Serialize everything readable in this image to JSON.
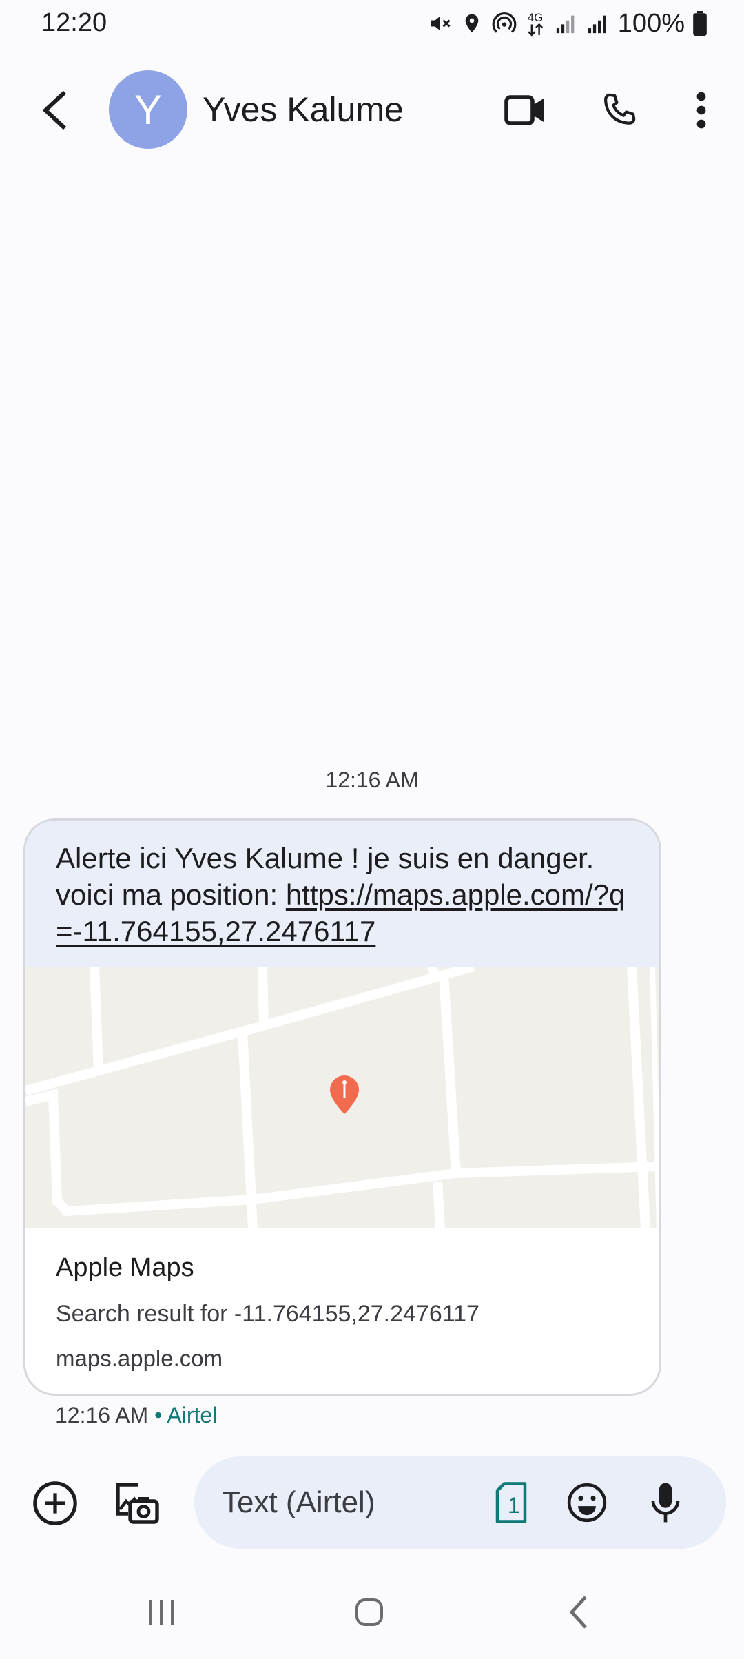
{
  "status_bar": {
    "time": "12:20",
    "battery": "100%",
    "network_type": "4G",
    "icons": [
      "mute-icon",
      "location-icon",
      "hotspot-icon",
      "4g-icon",
      "signal-icon",
      "signal-icon",
      "battery-icon"
    ]
  },
  "header": {
    "avatar_letter": "Y",
    "contact_name": "Yves Kalume",
    "back_icon": "back-arrow-icon",
    "actions": [
      "video-call-icon",
      "phone-icon",
      "more-vert-icon"
    ]
  },
  "conversation": {
    "date_stamp": "12:16 AM",
    "message": {
      "text_before_link": "Alerte ici Yves Kalume ! je suis en danger. voici ma position: ",
      "link_text": "https://maps.apple.com/?q=-11.764155,27.2476117",
      "preview": {
        "title": "Apple Maps",
        "description": "Search result for -11.764155,27.2476117",
        "domain": "maps.apple.com",
        "map_pin_icon": "map-pin-icon"
      },
      "time": "12:16 AM",
      "separator": " • ",
      "carrier": "Airtel"
    }
  },
  "composer": {
    "placeholder": "Text (Airtel)",
    "sim_label": "1",
    "icons": [
      "add-circle-icon",
      "gallery-camera-icon",
      "sim-1-icon",
      "emoji-icon",
      "mic-icon"
    ]
  },
  "nav_bar": {
    "icons": [
      "recent-apps-icon",
      "home-icon",
      "back-icon"
    ]
  },
  "colors": {
    "avatar": "#8ea3e6",
    "bubble": "#e9eef8",
    "carrier": "#0f7a75",
    "map_pin": "#f26b4f",
    "map_bg": "#f1efe9"
  }
}
